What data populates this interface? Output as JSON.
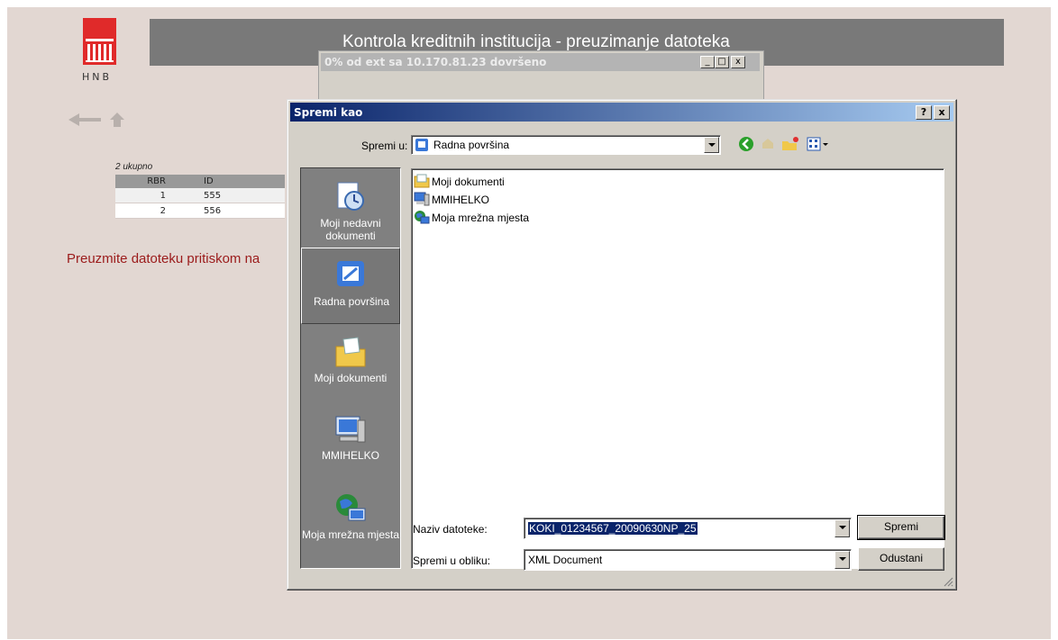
{
  "header": {
    "logo_text": "HNB",
    "title": "Kontrola kreditnih institucija - preuzimanje datoteka"
  },
  "nav": {
    "back_icon": "back-arrow-icon",
    "home_icon": "home-icon"
  },
  "list": {
    "total_label": "2 ukupno",
    "columns": [
      "RBR",
      "ID"
    ],
    "rows": [
      {
        "rbr": "1",
        "id": "555"
      },
      {
        "rbr": "2",
        "id": "556"
      }
    ]
  },
  "instruction": "Preuzmite datoteku pritiskom na",
  "progress_window": {
    "title": "0% od ext sa 10.170.81.23 dovršeno",
    "minimize": "_",
    "maximize": "□",
    "close": "x"
  },
  "dialog": {
    "title": "Spremi kao",
    "help_button": "?",
    "close_button": "x",
    "save_in_label": "Spremi u:",
    "save_in_value": "Radna površina",
    "places": [
      {
        "label": "Moji nedavni dokumenti",
        "icon": "recent-documents-icon"
      },
      {
        "label": "Radna površina",
        "icon": "desktop-icon"
      },
      {
        "label": "Moji dokumenti",
        "icon": "my-documents-icon"
      },
      {
        "label": "MMIHELKO",
        "icon": "my-computer-icon"
      },
      {
        "label": "Moja mrežna mjesta",
        "icon": "network-places-icon"
      }
    ],
    "files": [
      {
        "name": "Moji dokumenti",
        "icon": "folder-icon"
      },
      {
        "name": "MMIHELKO",
        "icon": "computer-icon"
      },
      {
        "name": "Moja mrežna mjesta",
        "icon": "network-icon"
      }
    ],
    "filename_label": "Naziv datoteke:",
    "filename_value": "KOKI_01234567_20090630NP_25",
    "filetype_label": "Spremi u obliku:",
    "filetype_value": "XML Document",
    "save_button": "Spremi",
    "cancel_button": "Odustani"
  }
}
